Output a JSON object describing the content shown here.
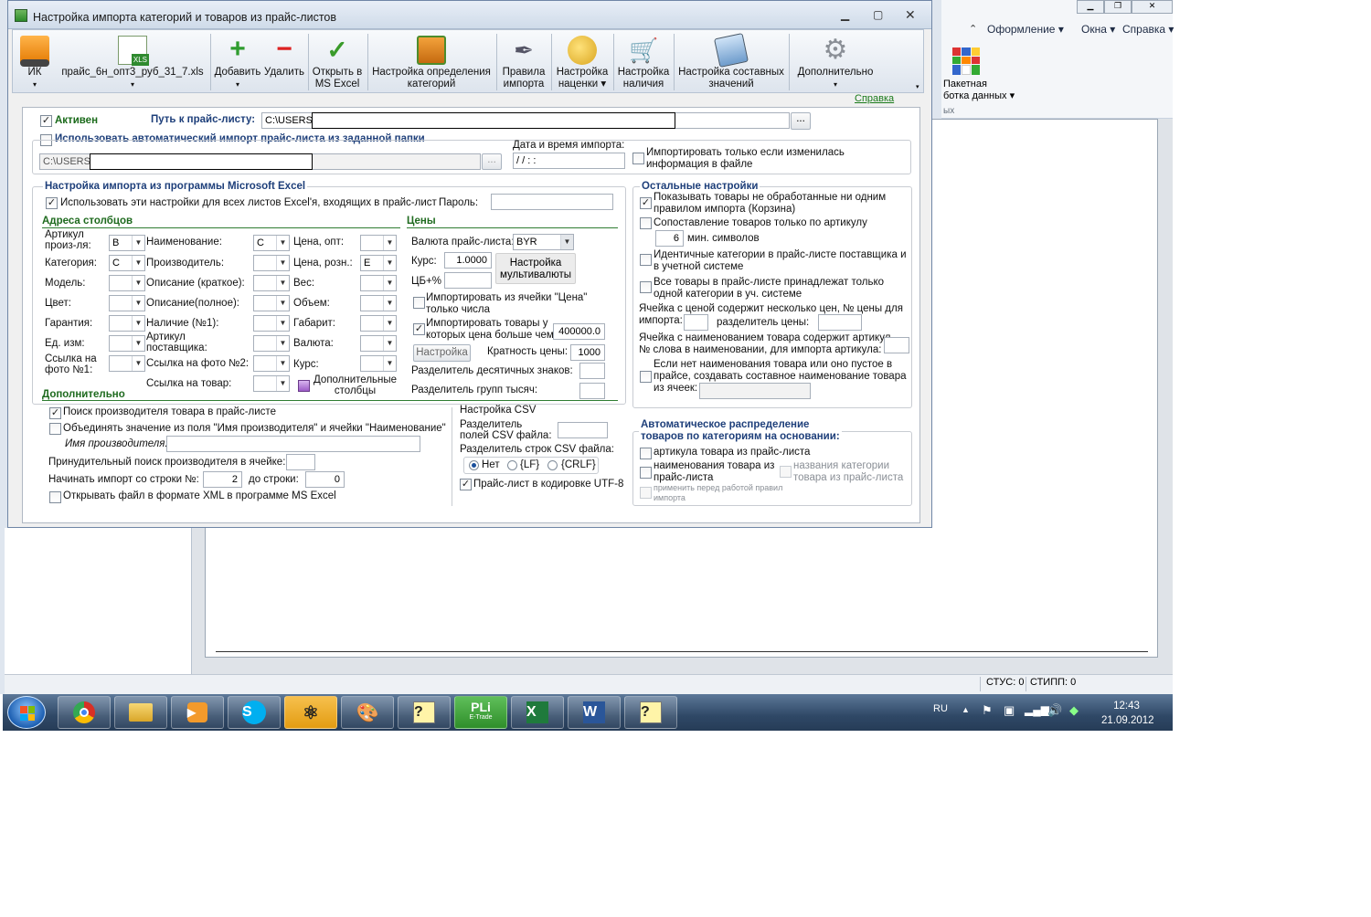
{
  "background_app": {
    "menu": [
      "Оформление",
      "Окна",
      "Справка"
    ],
    "ribbon_button": {
      "line1": "Пакетная",
      "line2": "ботка данных"
    },
    "ribbon_group_fragment": "ых",
    "status": [
      "СТУС: 0",
      "СТИПП: 0"
    ]
  },
  "taskbar": {
    "apps": [
      "start-orb",
      "chrome",
      "explorer",
      "media-player",
      "skype",
      "app-atom",
      "paint",
      "help-app",
      "PLi",
      "excel",
      "word",
      "help-app-2"
    ],
    "pli_label": "PLi",
    "pli_sublabel": "E-Trade",
    "lang": "RU",
    "time": "12:43",
    "date": "21.09.2012"
  },
  "dialog": {
    "title": "Настройка импорта категорий и товаров из прайс-листов",
    "toolbar": {
      "ik": "ИК",
      "file": "прайс_6н_опт3_руб_31_7.xls",
      "add": "Добавить",
      "delete": "Удалить",
      "open_excel_1": "Открыть в",
      "open_excel_2": "MS Excel",
      "cat_def_1": "Настройка определения",
      "cat_def_2": "категорий",
      "rules_1": "Правила",
      "rules_2": "импорта",
      "markup_1": "Настройка",
      "markup_2": "наценки",
      "stock_1": "Настройка",
      "stock_2": "наличия",
      "composite_1": "Настройка составных",
      "composite_2": "значений",
      "more": "Дополнительно",
      "help_link": "Справка"
    },
    "active_label": "Активен",
    "path_label": "Путь к прайс-листу:",
    "path_value": "C:\\USERS\\",
    "browse": "...",
    "auto_import_label": "Использовать автоматический импорт прайс-листа из заданной папки",
    "auto_path": "C:\\USERS\\",
    "datetime_label": "Дата и время импорта:",
    "datetime_value": " / /      : :",
    "import_if_changed": "Импортировать только если изменилась информация в файле",
    "excel": {
      "header": "Настройка импорта из программы Microsoft Excel",
      "all_sheets": "Использовать эти настройки для всех листов Excel'я, входящих в прайс-лист",
      "password_label": "Пароль:",
      "columns_header": "Адреса столбцов",
      "prices_header": "Цены",
      "col1": [
        {
          "label1": "Артикул",
          "label2": "произ-ля:",
          "value": "B"
        },
        {
          "label1": "Категория:",
          "value": "C"
        },
        {
          "label1": "Модель:",
          "value": ""
        },
        {
          "label1": "Цвет:",
          "value": ""
        },
        {
          "label1": "Гарантия:",
          "value": ""
        },
        {
          "label1": "Ед. изм:",
          "value": ""
        },
        {
          "label1": "Ссылка на",
          "label2": "фото №1:",
          "value": ""
        }
      ],
      "col2": [
        {
          "label1": "Наименование:",
          "value": "C"
        },
        {
          "label1": "Производитель:",
          "value": ""
        },
        {
          "label1": "Описание (краткое):",
          "value": ""
        },
        {
          "label1": "Описание(полное):",
          "value": ""
        },
        {
          "label1": "Наличие (№1):",
          "value": ""
        },
        {
          "label1": "Артикул",
          "label2": "поставщика:",
          "value": ""
        },
        {
          "label1": "Ссылка на фото №2:",
          "value": ""
        },
        {
          "label1": "Ссылка на товар:",
          "value": ""
        }
      ],
      "col3": [
        {
          "label1": "Цена, опт:",
          "value": ""
        },
        {
          "label1": "Цена, розн.:",
          "value": "E"
        },
        {
          "label1": "Вес:",
          "value": ""
        },
        {
          "label1": "Объем:",
          "value": ""
        },
        {
          "label1": "Габарит:",
          "value": ""
        },
        {
          "label1": "Валюта:",
          "value": ""
        },
        {
          "label1": "Курс:",
          "value": ""
        }
      ],
      "extra_columns_1": "Дополнительные",
      "extra_columns_2": "столбцы",
      "currency_label": "Валюта прайс-листа:",
      "currency_value": "BYR",
      "rate_label": "Курс:",
      "rate_value": "1.0000",
      "cb_label": "ЦБ+%",
      "multicurrency_1": "Настройка",
      "multicurrency_2": "мультивалюты",
      "import_price_numbers_1": "Импортировать из ячейки \"Цена\"",
      "import_price_numbers_2": "только числа",
      "import_greater_1": "Импортировать товары у",
      "import_greater_2": "которых цена больше чем:",
      "greater_value": "400000.0",
      "setup_button": "Настройка",
      "multiplicity_label": "Кратность цены:",
      "multiplicity_value": "1000",
      "decimal_sep_label": "Разделитель десятичных знаков:",
      "group_sep_label": "Разделитель групп тысяч:"
    },
    "additional": {
      "header": "Дополнительно",
      "search_manufacturer": "Поиск производителя товара в прайс-листе",
      "merge_fields": "Объединять значение из поля \"Имя производителя\" и ячейки \"Наименование\"",
      "manufacturer_name_label": "Имя производителя:",
      "forced_search_label": "Принудительный поиск производителя в ячейке:",
      "start_row_label": "Начинать импорт со строки №:",
      "start_row_value": "2",
      "end_row_label": "до строки:",
      "end_row_value": "0",
      "open_xml": "Открывать файл в формате XML в программе MS Excel"
    },
    "csv": {
      "header": "Настройка CSV",
      "field_sep_1": "Разделитель",
      "field_sep_2": "полей CSV файла:",
      "row_sep_label": "Разделитель строк CSV файла:",
      "options": [
        "Нет",
        "{LF}",
        "{CRLF}"
      ],
      "utf8": "Прайс-лист в кодировке UTF-8"
    },
    "other": {
      "header": "Остальные настройки",
      "show_unprocessed_1": "Показывать товары не обработанные ни одним",
      "show_unprocessed_2": "правилом импорта (Корзина)",
      "match_by_sku": "Сопоставление товаров только по артикулу",
      "min_chars_value": "6",
      "min_chars_label": "мин. символов",
      "identical_cats_1": "Идентичные категории в прайс-листе поставщика и",
      "identical_cats_2": "в учетной системе",
      "single_category_1": "Все товары в прайс-листе принадлежат только",
      "single_category_2": "одной категории в уч. системе",
      "multi_price_1": "Ячейка с ценой содержит несколько цен, № цены для",
      "multi_price_2": "импорта:",
      "price_sep_label": "разделитель цены:",
      "name_contains_sku_1": "Ячейка с наименованием товара содержит артикул,",
      "name_contains_sku_2": "№ слова в наименовании, для импорта артикула:",
      "no_name_1": "Если нет наименования товара или оно пустое в",
      "no_name_2": "прайсе, создавать составное наименование товара",
      "no_name_3": "из ячеек:"
    },
    "auto_dist": {
      "header_1": "Автоматическое распределение",
      "header_2": "товаров по категориям на основании:",
      "by_sku": "артикула товара из прайс-листа",
      "by_name_1": "наименования товара из",
      "by_name_2": "прайс-листа",
      "by_category_1": "названия  категории",
      "by_category_2": "товара из прайс-листа",
      "apply_rules_1": "применить перед работой правил",
      "apply_rules_2": "импорта"
    }
  },
  "colors": {
    "header_blue": "#1e3f7a",
    "green_line": "#2f7d32",
    "link_green": "#1a7a1a"
  }
}
